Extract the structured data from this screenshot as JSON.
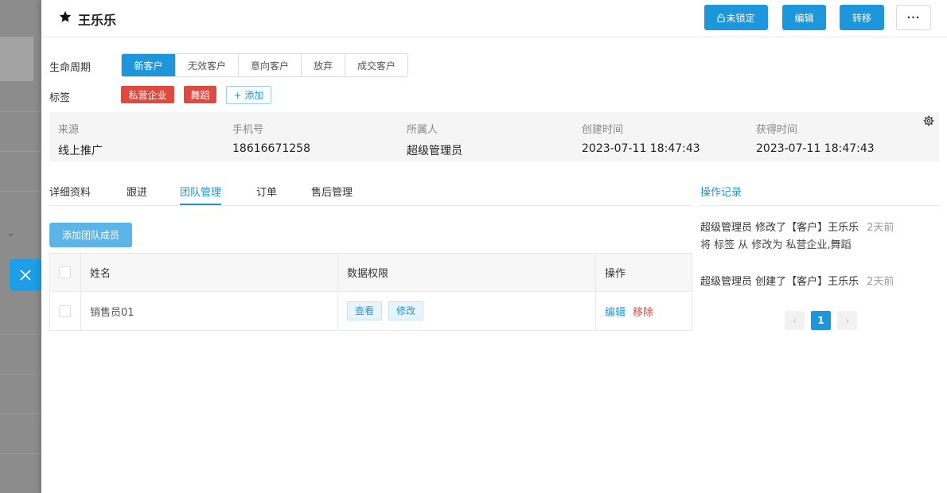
{
  "header": {
    "title": "王乐乐",
    "lock_button": "未锁定",
    "edit_button": "编辑",
    "transfer_button": "转移",
    "more_button": "···"
  },
  "lifecycle": {
    "label": "生命周期",
    "stages": [
      "新客户",
      "无效客户",
      "意向客户",
      "放弃",
      "成交客户"
    ],
    "active": "新客户"
  },
  "tags": {
    "label": "标签",
    "items": [
      "私营企业",
      "舞蹈"
    ],
    "add_label": "+ 添加"
  },
  "info": {
    "fields": [
      {
        "key": "来源",
        "value": "线上推广"
      },
      {
        "key": "手机号",
        "value": "18616671258"
      },
      {
        "key": "所属人",
        "value": "超级管理员"
      },
      {
        "key": "创建时间",
        "value": "2023-07-11 18:47:43"
      },
      {
        "key": "获得时间",
        "value": "2023-07-11 18:47:43"
      }
    ]
  },
  "tabs": {
    "items": [
      "详细资料",
      "跟进",
      "团队管理",
      "订单",
      "售后管理"
    ],
    "active": "团队管理"
  },
  "team": {
    "add_button": "添加团队成员",
    "columns": [
      "姓名",
      "数据权限",
      "操作"
    ],
    "rows": [
      {
        "name": "销售员01",
        "permissions": [
          "查看",
          "修改"
        ],
        "actions": [
          "编辑",
          "移除"
        ]
      }
    ]
  },
  "log": {
    "tab_label": "操作记录",
    "entries": [
      {
        "text": "超级管理员 修改了【客户】王乐乐",
        "time": "2天前",
        "detail": "将 标签 从 修改为 私营企业,舞蹈"
      },
      {
        "text": "超级管理员 创建了【客户】王乐乐",
        "time": "2天前"
      }
    ],
    "pagination": {
      "current": "1",
      "prev": "‹",
      "next": "›"
    }
  },
  "colors": {
    "primary": "#1e96dc",
    "danger": "#e0493e"
  }
}
